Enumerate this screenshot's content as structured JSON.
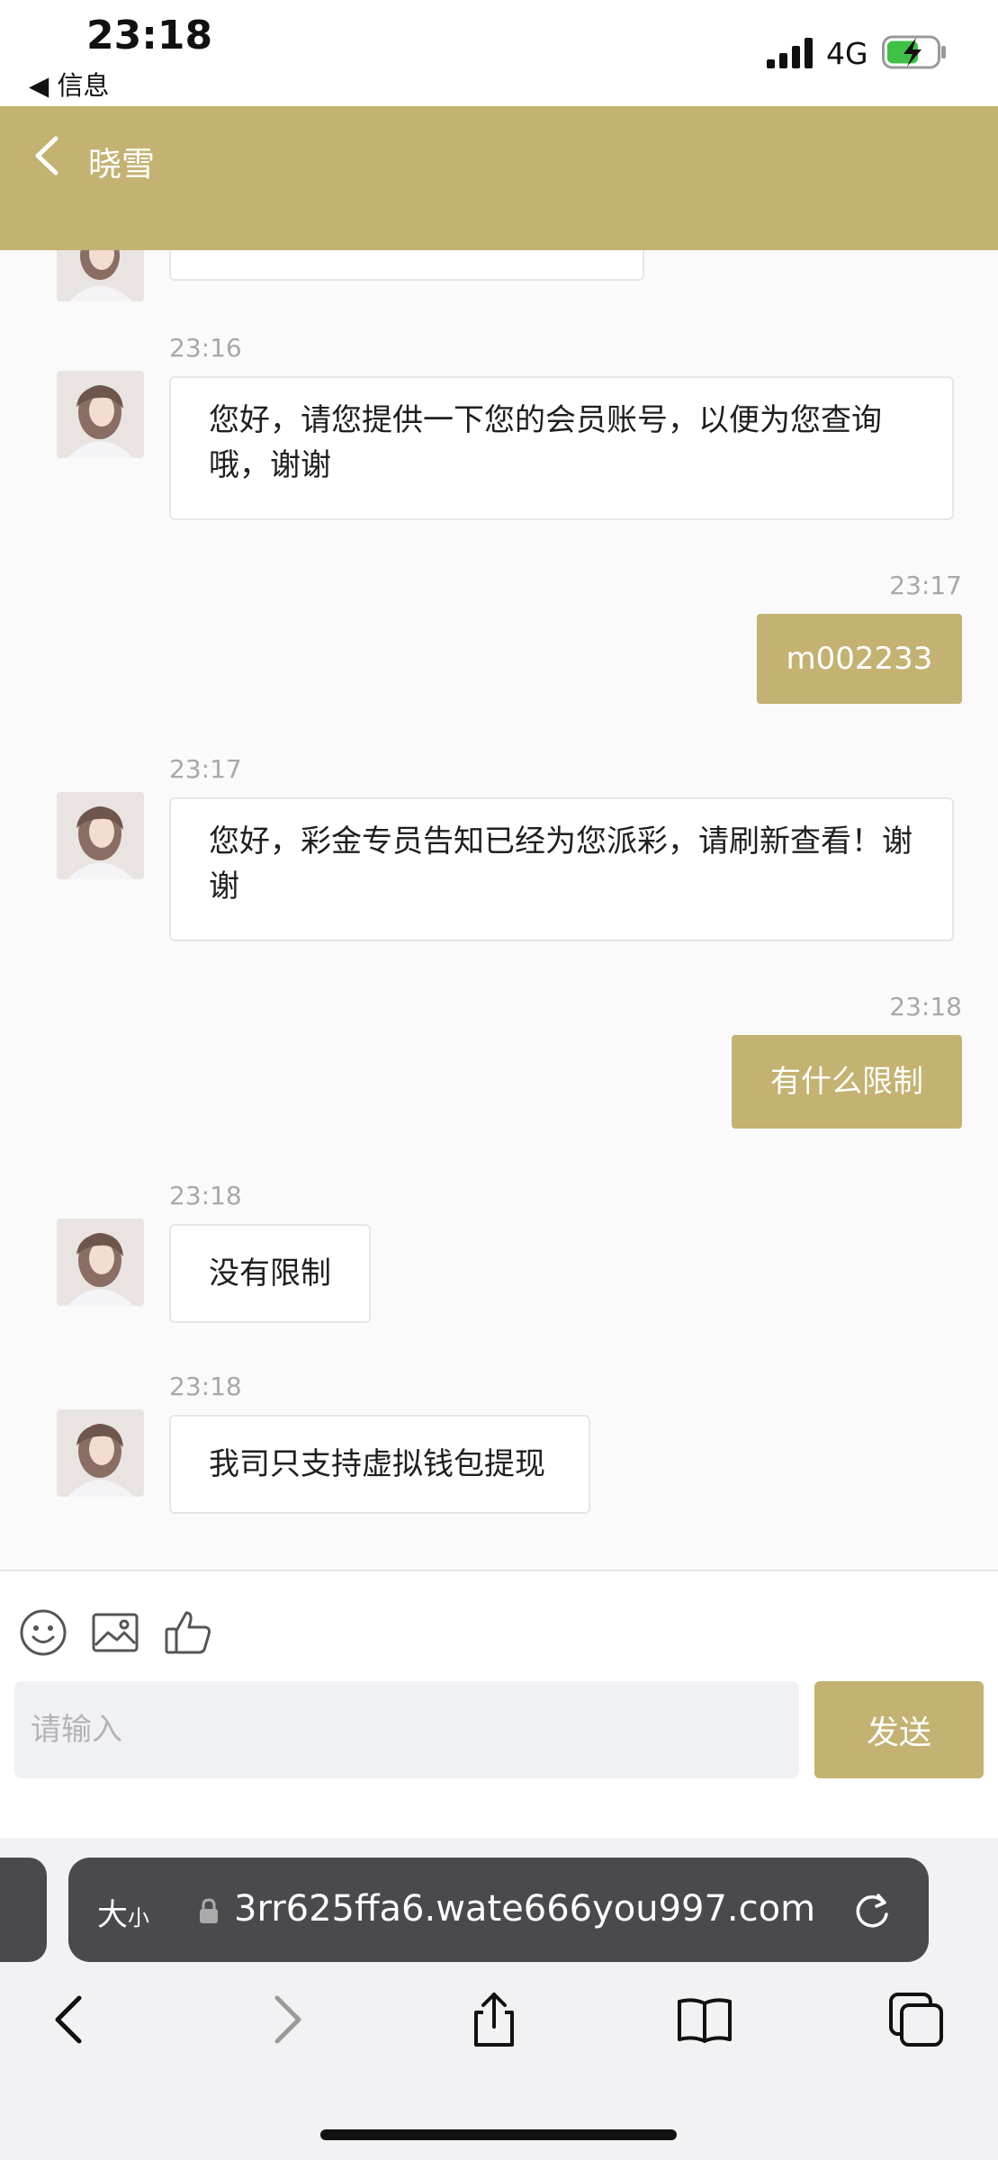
{
  "status_bar": {
    "time": "23:18",
    "back_app": "◀ 信息",
    "network": "4G"
  },
  "header": {
    "title": "晓雪"
  },
  "messages": [
    {
      "from": "agent",
      "time": "23:16",
      "text": "您好，请您提供一下您的会员账号，以便为您查询哦，谢谢"
    },
    {
      "from": "user",
      "time": "23:17",
      "text": "m002233"
    },
    {
      "from": "agent",
      "time": "23:17",
      "text": "您好，彩金专员告知已经为您派彩，请刷新查看！谢谢"
    },
    {
      "from": "user",
      "time": "23:18",
      "text": "有什么限制"
    },
    {
      "from": "agent",
      "time": "23:18",
      "text": "没有限制"
    },
    {
      "from": "agent",
      "time": "23:18",
      "text": "我司只支持虚拟钱包提现"
    }
  ],
  "composer": {
    "placeholder": "请输入",
    "send_label": "发送"
  },
  "browser": {
    "text_size_big": "大",
    "text_size_small": "小",
    "url": "3rr625ffa6.wate666you997.com"
  },
  "icons": [
    "emoji-icon",
    "image-icon",
    "thumbs-up-icon",
    "lock-icon",
    "reload-icon",
    "back-icon",
    "forward-icon",
    "share-icon",
    "bookmarks-icon",
    "tabs-icon"
  ],
  "colors": {
    "accent": "#c3b271",
    "bubble_in": "#ffffff",
    "timestamp": "#a8a8a8"
  }
}
